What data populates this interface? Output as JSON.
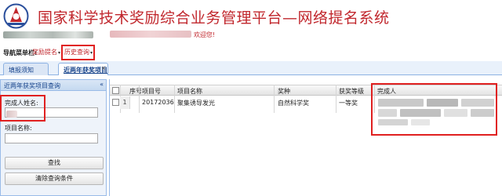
{
  "header": {
    "system_title": "国家科学技术奖励综合业务管理平台—网络提名系统",
    "welcome_text": "欢迎您!"
  },
  "nav": {
    "label": "导航菜单栏:",
    "items": [
      {
        "label": "奖励提名",
        "caret": "▾"
      },
      {
        "label": "历史查询",
        "caret": "▾"
      }
    ]
  },
  "tabs": [
    {
      "label": "填报须知"
    },
    {
      "label": "近两年获奖项目",
      "close": "×"
    }
  ],
  "query_panel": {
    "title": "近两年获奖项目查询",
    "collapse_icon": "«",
    "fields": [
      {
        "label": "完成人姓名:",
        "value": "",
        "placeholder": ""
      },
      {
        "label": "项目名称:",
        "value": "",
        "placeholder": ""
      }
    ],
    "buttons": {
      "search": "查找",
      "clear": "清除查询条件"
    }
  },
  "grid": {
    "columns": [
      "序号",
      "项目号",
      "项目名称",
      "奖种",
      "获奖等级",
      "完成人"
    ],
    "rows": [
      {
        "seq": "1",
        "project_no": "20172036",
        "project_name": "聚集诱导发光",
        "award_type": "自然科学奖",
        "level": "一等奖"
      }
    ]
  },
  "colors": {
    "title_red": "#c1272d",
    "highlight_red": "#e02020",
    "panel_blue": "#99bbe8"
  }
}
